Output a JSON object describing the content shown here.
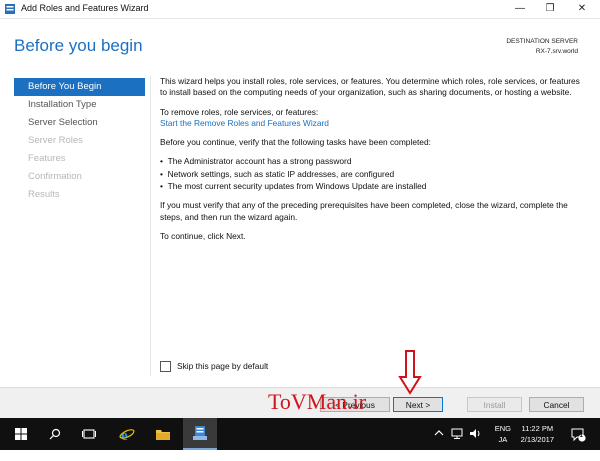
{
  "window": {
    "title": "Add Roles and Features Wizard",
    "controls": {
      "minimize": "—",
      "maximize": "❐",
      "close": "✕"
    }
  },
  "header": {
    "title": "Before you begin",
    "destination_label": "DESTINATION SERVER",
    "destination_server": "RX-7.srv.world"
  },
  "nav": {
    "items": [
      {
        "label": "Before You Begin",
        "state": "active"
      },
      {
        "label": "Installation Type",
        "state": "normal"
      },
      {
        "label": "Server Selection",
        "state": "normal"
      },
      {
        "label": "Server Roles",
        "state": "disabled"
      },
      {
        "label": "Features",
        "state": "disabled"
      },
      {
        "label": "Confirmation",
        "state": "disabled"
      },
      {
        "label": "Results",
        "state": "disabled"
      }
    ]
  },
  "content": {
    "intro": "This wizard helps you install roles, role services, or features. You determine which roles, role services, or features to install based on the computing needs of your organization, such as sharing documents, or hosting a website.",
    "remove_label": "To remove roles, role services, or features:",
    "remove_link": "Start the Remove Roles and Features Wizard",
    "verify": "Before you continue, verify that the following tasks have been completed:",
    "bullets": [
      "The Administrator account has a strong password",
      "Network settings, such as static IP addresses, are configured",
      "The most current security updates from Windows Update are installed"
    ],
    "prereq": "If you must verify that any of the preceding prerequisites have been completed, close the wizard, complete the steps, and then run the wizard again.",
    "continue": "To continue, click Next.",
    "skip_label": "Skip this page by default"
  },
  "footer": {
    "previous": "< Previous",
    "next": "Next >",
    "install": "Install",
    "cancel": "Cancel"
  },
  "watermark": "ToVMan.ir",
  "taskbar": {
    "lang_top": "ENG",
    "lang_bottom": "JA",
    "time": "11:22 PM",
    "date": "2/13/2017",
    "notification_count": "1"
  },
  "colors": {
    "accent": "#1b70c2",
    "watermark": "#d0141c",
    "taskbar": "#101010"
  }
}
